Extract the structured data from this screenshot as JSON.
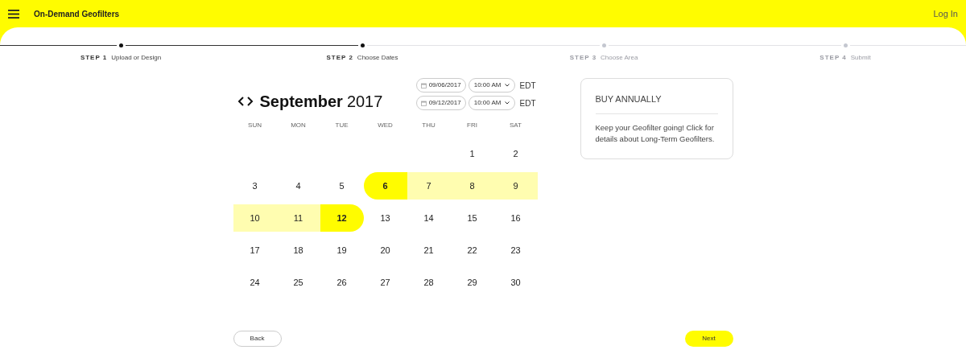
{
  "header": {
    "title": "On-Demand Geofilters",
    "login": "Log In"
  },
  "steps": [
    {
      "number": "STEP 1",
      "label": "Upload or Design",
      "done": true
    },
    {
      "number": "STEP 2",
      "label": "Choose Dates",
      "done": true
    },
    {
      "number": "STEP 3",
      "label": "Choose Area",
      "done": false
    },
    {
      "number": "STEP 4",
      "label": "Submit",
      "done": false
    }
  ],
  "calendar": {
    "month": "September",
    "year": "2017",
    "weekdays": [
      "SUN",
      "MON",
      "TUE",
      "WED",
      "THU",
      "FRI",
      "SAT"
    ],
    "weeks": [
      [
        {
          "day": "1",
          "kind": "plain"
        },
        {
          "day": "2",
          "kind": "plain"
        }
      ],
      [
        {
          "day": "3",
          "kind": "plain"
        },
        {
          "day": "4",
          "kind": "plain"
        },
        {
          "day": "5",
          "kind": "plain"
        },
        {
          "day": "6",
          "kind": "start"
        },
        {
          "day": "7",
          "kind": "range"
        },
        {
          "day": "8",
          "kind": "range"
        },
        {
          "day": "9",
          "kind": "range"
        }
      ],
      [
        {
          "day": "10",
          "kind": "range"
        },
        {
          "day": "11",
          "kind": "range"
        },
        {
          "day": "12",
          "kind": "end"
        },
        {
          "day": "13",
          "kind": "plain"
        },
        {
          "day": "14",
          "kind": "plain"
        },
        {
          "day": "15",
          "kind": "plain"
        },
        {
          "day": "16",
          "kind": "plain"
        }
      ],
      [
        {
          "day": "17",
          "kind": "plain"
        },
        {
          "day": "18",
          "kind": "plain"
        },
        {
          "day": "19",
          "kind": "plain"
        },
        {
          "day": "20",
          "kind": "plain"
        },
        {
          "day": "21",
          "kind": "plain"
        },
        {
          "day": "22",
          "kind": "plain"
        },
        {
          "day": "23",
          "kind": "plain"
        }
      ],
      [
        {
          "day": "24",
          "kind": "plain"
        },
        {
          "day": "25",
          "kind": "plain"
        },
        {
          "day": "26",
          "kind": "plain"
        },
        {
          "day": "27",
          "kind": "plain"
        },
        {
          "day": "28",
          "kind": "plain"
        },
        {
          "day": "29",
          "kind": "plain"
        },
        {
          "day": "30",
          "kind": "plain"
        }
      ]
    ]
  },
  "date_ranges": [
    {
      "date": "09/06/2017",
      "time": "10:00 AM",
      "timezone": "EDT"
    },
    {
      "date": "09/12/2017",
      "time": "10:00 AM",
      "timezone": "EDT"
    }
  ],
  "annual_card": {
    "title": "BUY ANNUALLY",
    "text": "Keep your Geofilter going! Click for details about Long-Term Geofilters."
  },
  "buttons": {
    "back": "Back",
    "next": "Next"
  }
}
